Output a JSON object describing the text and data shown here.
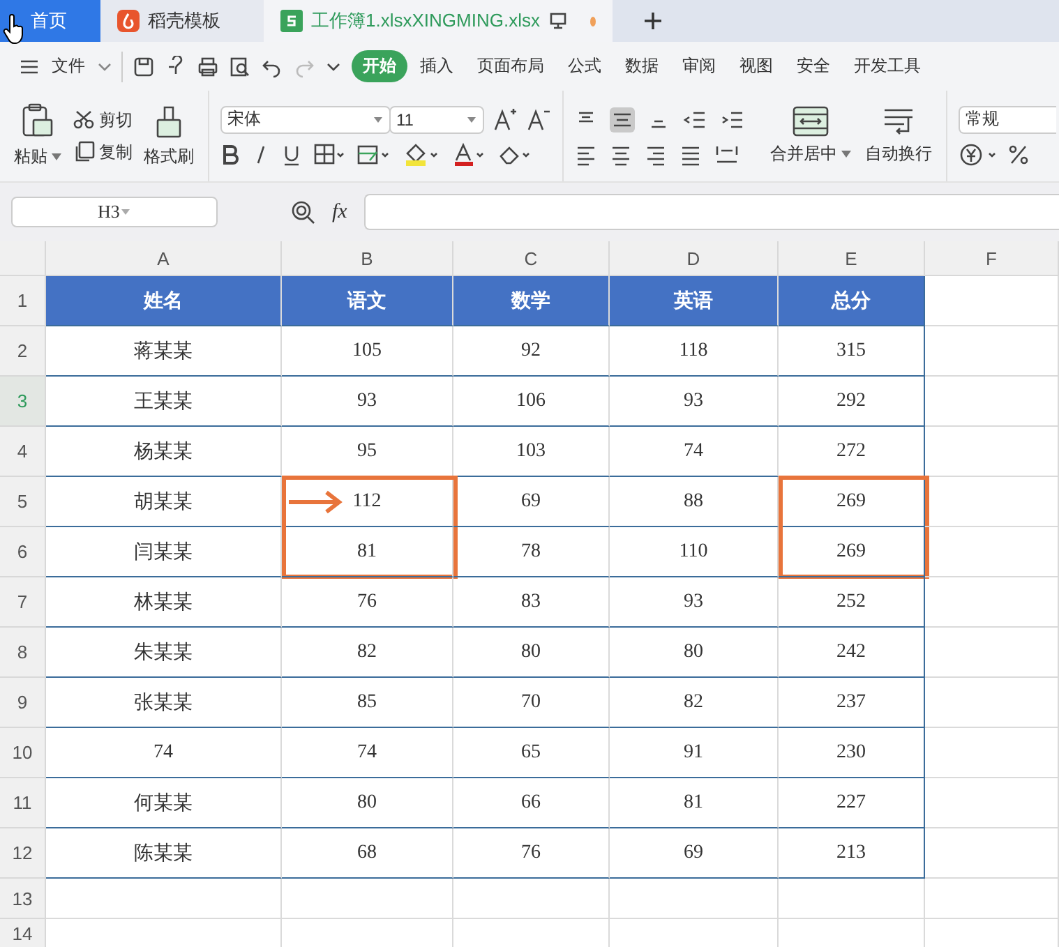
{
  "tabs": [
    {
      "label": "首页",
      "kind": "home",
      "selected": false
    },
    {
      "label": "稻壳模板",
      "kind": "template",
      "selected": false
    },
    {
      "label": "工作簿1.xlsxXINGMING.xlsx",
      "kind": "sheet",
      "selected": true
    }
  ],
  "menu": [
    {
      "label": "文件",
      "selected": false
    },
    {
      "label": "开始",
      "selected": true
    },
    {
      "label": "插入",
      "selected": false
    },
    {
      "label": "页面布局",
      "selected": false
    },
    {
      "label": "公式",
      "selected": false
    },
    {
      "label": "数据",
      "selected": false
    },
    {
      "label": "审阅",
      "selected": false
    },
    {
      "label": "视图",
      "selected": false
    },
    {
      "label": "安全",
      "selected": false
    },
    {
      "label": "开发工具",
      "selected": false
    }
  ],
  "ribbon": {
    "paste": "粘贴",
    "cut": "剪切",
    "copy": "复制",
    "format_painter": "格式刷",
    "font": "宋体",
    "font_size": "11",
    "merge": "合并居中",
    "wrap": "自动换行",
    "number_format": "常规"
  },
  "formula_bar": {
    "name_box": "H3",
    "fx": "fx"
  },
  "columns": [
    "A",
    "B",
    "C",
    "D",
    "E",
    "F"
  ],
  "rows": [
    {
      "label": "1",
      "selected": false
    },
    {
      "label": "2",
      "selected": false
    },
    {
      "label": "3",
      "selected": true
    },
    {
      "label": "4",
      "selected": false
    },
    {
      "label": "5",
      "selected": false
    },
    {
      "label": "6",
      "selected": false
    },
    {
      "label": "7",
      "selected": false
    },
    {
      "label": "8",
      "selected": false
    },
    {
      "label": "9",
      "selected": false
    },
    {
      "label": "10",
      "selected": false
    },
    {
      "label": "11",
      "selected": false
    },
    {
      "label": "12",
      "selected": false
    },
    {
      "label": "13",
      "selected": false
    },
    {
      "label": "14",
      "selected": false
    }
  ],
  "table": {
    "header": [
      "姓名",
      "语文",
      "数学",
      "英语",
      "总分"
    ],
    "rows": [
      [
        "蒋某某",
        "105",
        "92",
        "118",
        "315"
      ],
      [
        "王某某",
        "93",
        "106",
        "93",
        "292"
      ],
      [
        "杨某某",
        "95",
        "103",
        "74",
        "272"
      ],
      [
        "胡某某",
        {
          "text": "112",
          "boxed": true,
          "arrow": true
        },
        "69",
        "88",
        {
          "text": "269",
          "boxed": true,
          "arrow": false
        }
      ],
      [
        "闫某某",
        {
          "text": "81",
          "boxed": true,
          "arrow": false
        },
        "78",
        "110",
        {
          "text": "269",
          "boxed": true,
          "arrow": false
        }
      ],
      [
        "林某某",
        "76",
        "83",
        "93",
        "252"
      ],
      [
        "朱某某",
        "82",
        "80",
        "80",
        "242"
      ],
      [
        "张某某",
        "85",
        "70",
        "82",
        "237"
      ],
      [
        "74",
        "74",
        "65",
        "91",
        "230"
      ],
      [
        "何某某",
        "80",
        "66",
        "81",
        "227"
      ],
      [
        "陈某某",
        "68",
        "76",
        "69",
        "213"
      ]
    ]
  }
}
